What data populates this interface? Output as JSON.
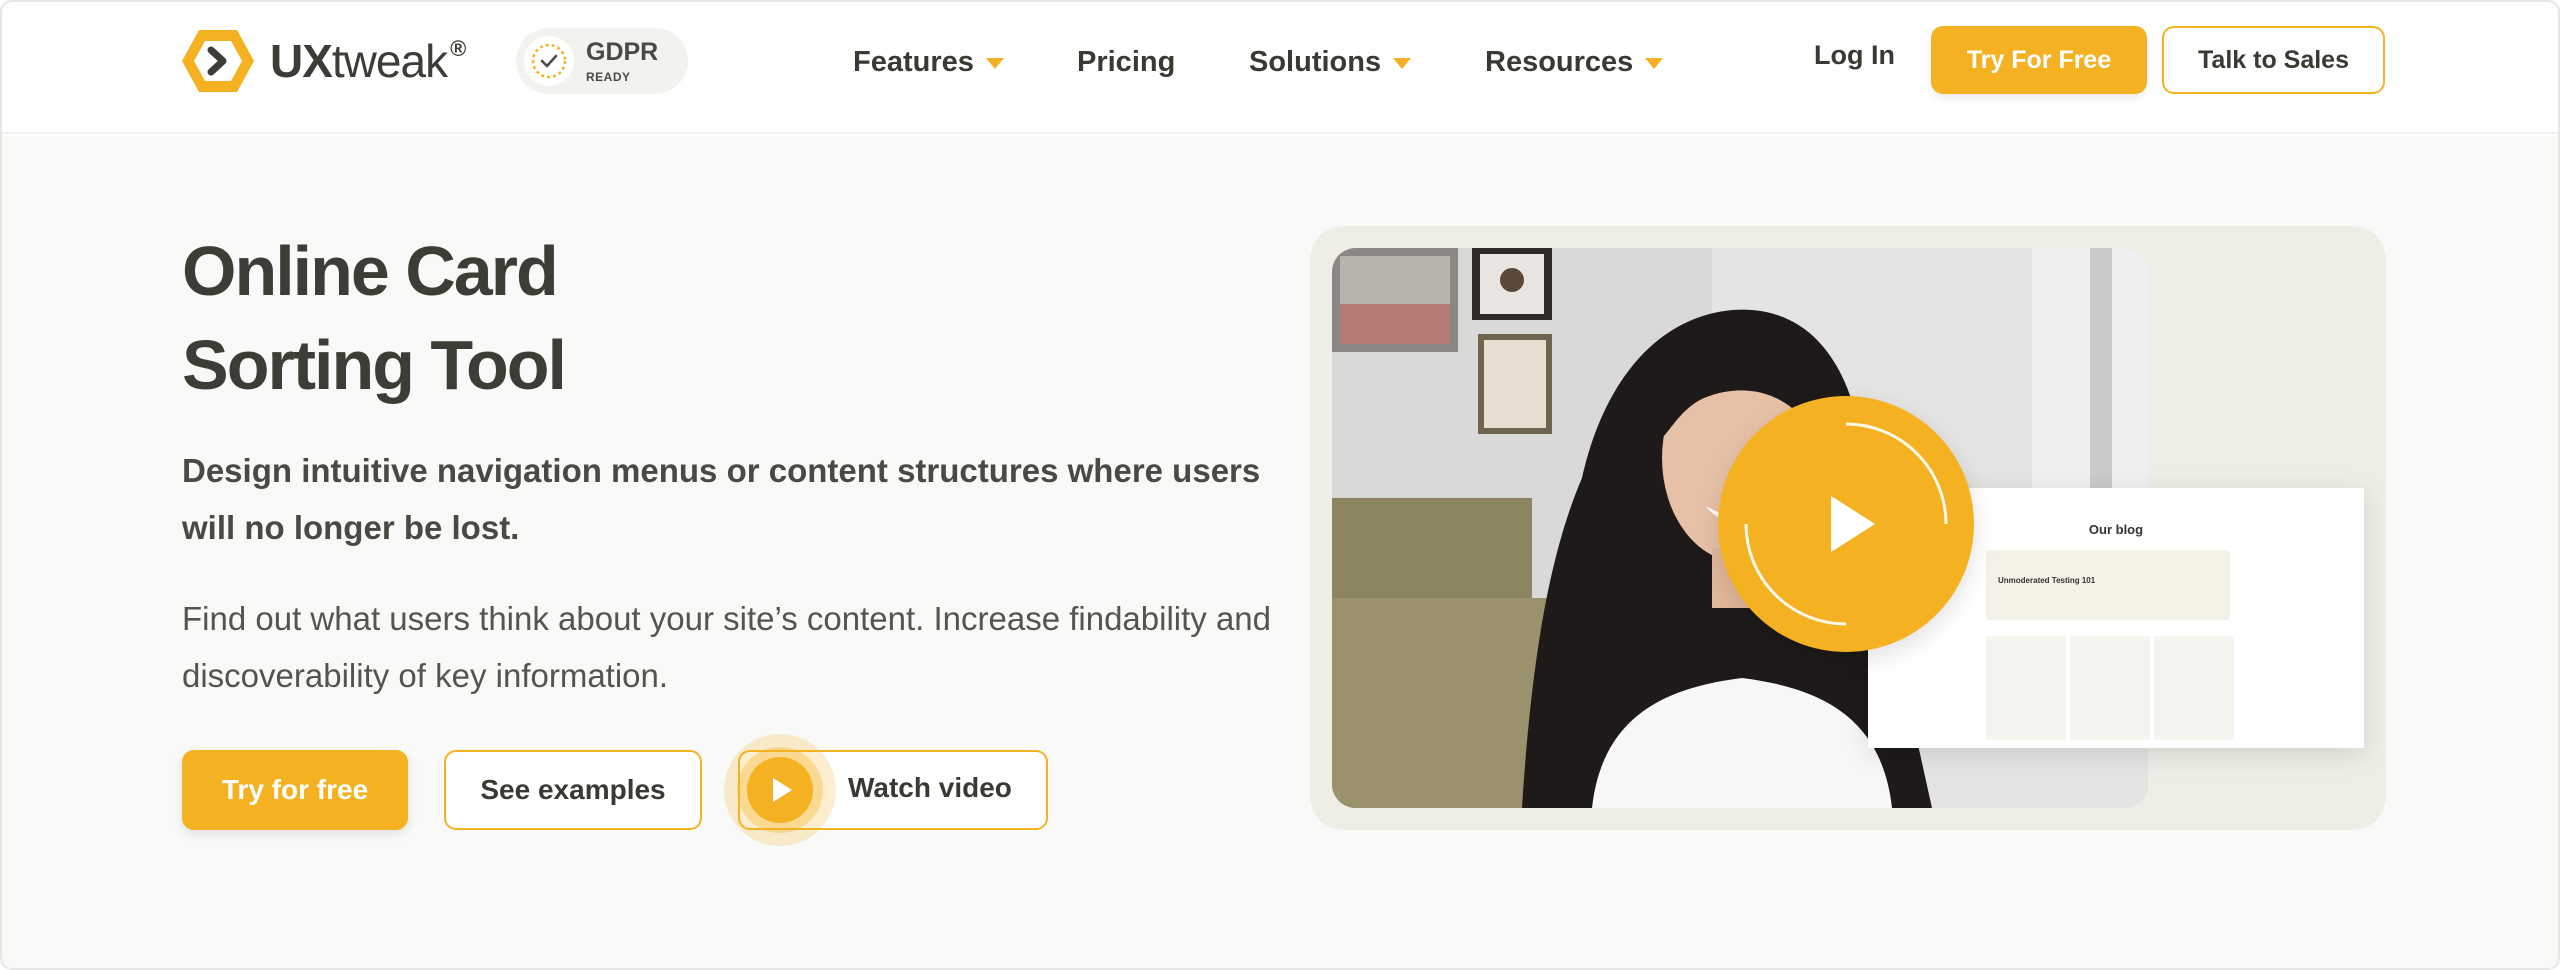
{
  "colors": {
    "accent": "#f4b223",
    "text_dark": "#3a3a33",
    "hero_bg": "#f9f9f8",
    "media_card_bg": "#eeede6"
  },
  "nav": {
    "logo": {
      "brand_bold": "UX",
      "brand_regular": "tweak",
      "registered": "®",
      "icon": "uxtweak-hexagon-chevron-icon"
    },
    "gdpr": {
      "title": "GDPR",
      "subtitle": "READY",
      "icon": "gdpr-check-seal-icon"
    },
    "menu": [
      {
        "label": "Features",
        "has_dropdown": true
      },
      {
        "label": "Pricing",
        "has_dropdown": false
      },
      {
        "label": "Solutions",
        "has_dropdown": true
      },
      {
        "label": "Resources",
        "has_dropdown": true
      }
    ],
    "login_label": "Log In",
    "try_label": "Try For Free",
    "sales_label": "Talk to Sales"
  },
  "hero": {
    "headline_line1": "Online Card",
    "headline_line2": "Sorting Tool",
    "lead": "Design intuitive navigation menus or content structures where users will no longer be lost.",
    "body": "Find out what users think about your site’s content. Increase findability and discoverability of key information.",
    "cta_try": "Try for free",
    "cta_examples": "See examples",
    "cta_video": "Watch video"
  },
  "media": {
    "play_icon": "play-icon",
    "blog_preview_title": "Our blog",
    "blog_preview_feature": "Unmoderated Testing 101"
  }
}
